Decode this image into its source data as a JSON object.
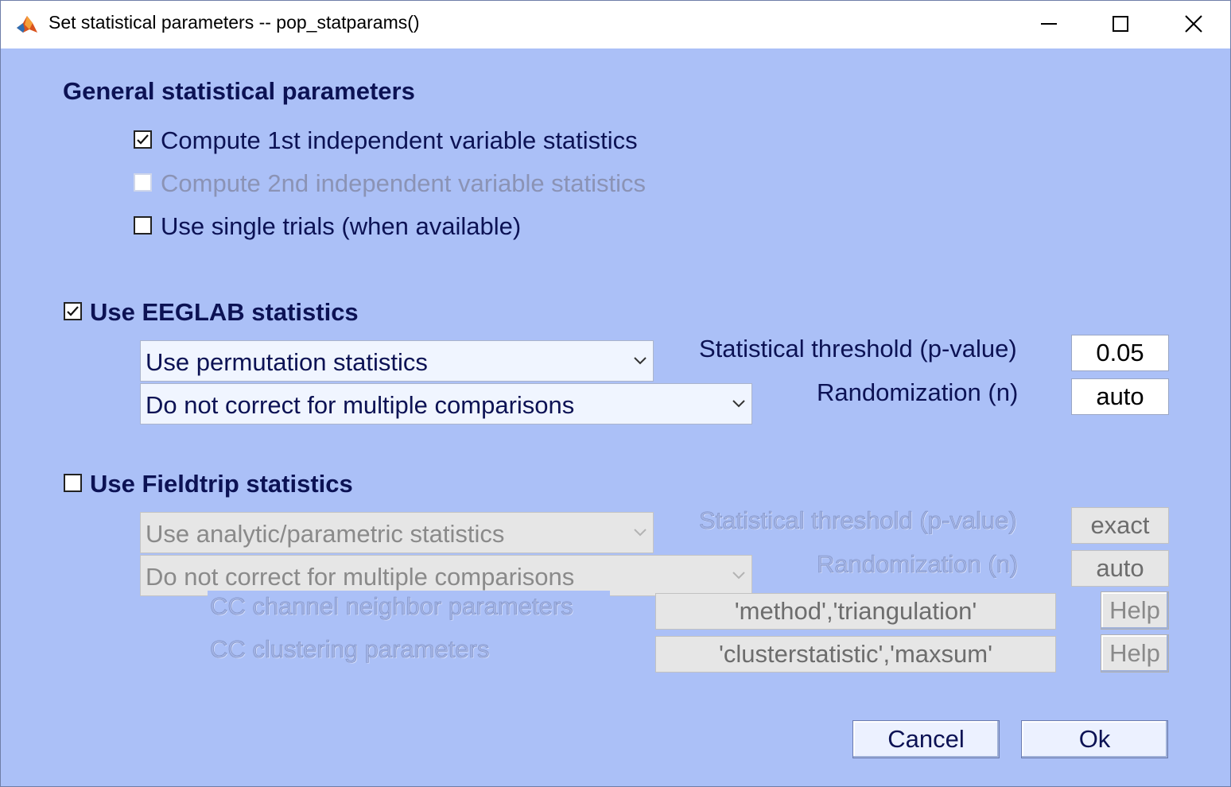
{
  "window": {
    "title": "Set statistical parameters -- pop_statparams()"
  },
  "general": {
    "heading": "General statistical parameters",
    "compute_1st": {
      "label": "Compute 1st independent variable statistics",
      "checked": true
    },
    "compute_2nd": {
      "label": "Compute 2nd independent variable statistics",
      "checked": false,
      "enabled": false
    },
    "single_trials": {
      "label": "Use single trials (when available)",
      "checked": false
    }
  },
  "eeglab": {
    "heading": "Use EEGLAB statistics",
    "checked": true,
    "method_select": "Use permutation statistics",
    "correction_select": "Do not correct for multiple comparisons",
    "threshold_label": "Statistical threshold (p-value)",
    "threshold_value": "0.05",
    "randomization_label": "Randomization (n)",
    "randomization_value": "auto"
  },
  "fieldtrip": {
    "heading": "Use Fieldtrip statistics",
    "checked": false,
    "method_select": "Use analytic/parametric statistics",
    "correction_select": "Do not correct for multiple comparisons",
    "threshold_label": "Statistical threshold (p-value)",
    "threshold_value": "exact",
    "randomization_label": "Randomization (n)",
    "randomization_value": "auto",
    "neighbor_label": "CC channel neighbor parameters",
    "neighbor_value": "'method','triangulation'",
    "cluster_label": "CC clustering parameters",
    "cluster_value": "'clusterstatistic','maxsum'",
    "help_label": "Help"
  },
  "buttons": {
    "cancel": "Cancel",
    "ok": "Ok"
  },
  "icons": {
    "app": "matlab-icon",
    "minimize": "minimize-icon",
    "maximize": "maximize-icon",
    "close": "close-icon",
    "check": "checkmark-icon",
    "dropdown": "chevron-down-icon"
  },
  "colors": {
    "panel": "#abc0f7",
    "text": "#0c1254",
    "disabled_field": "#e6e6e6"
  }
}
